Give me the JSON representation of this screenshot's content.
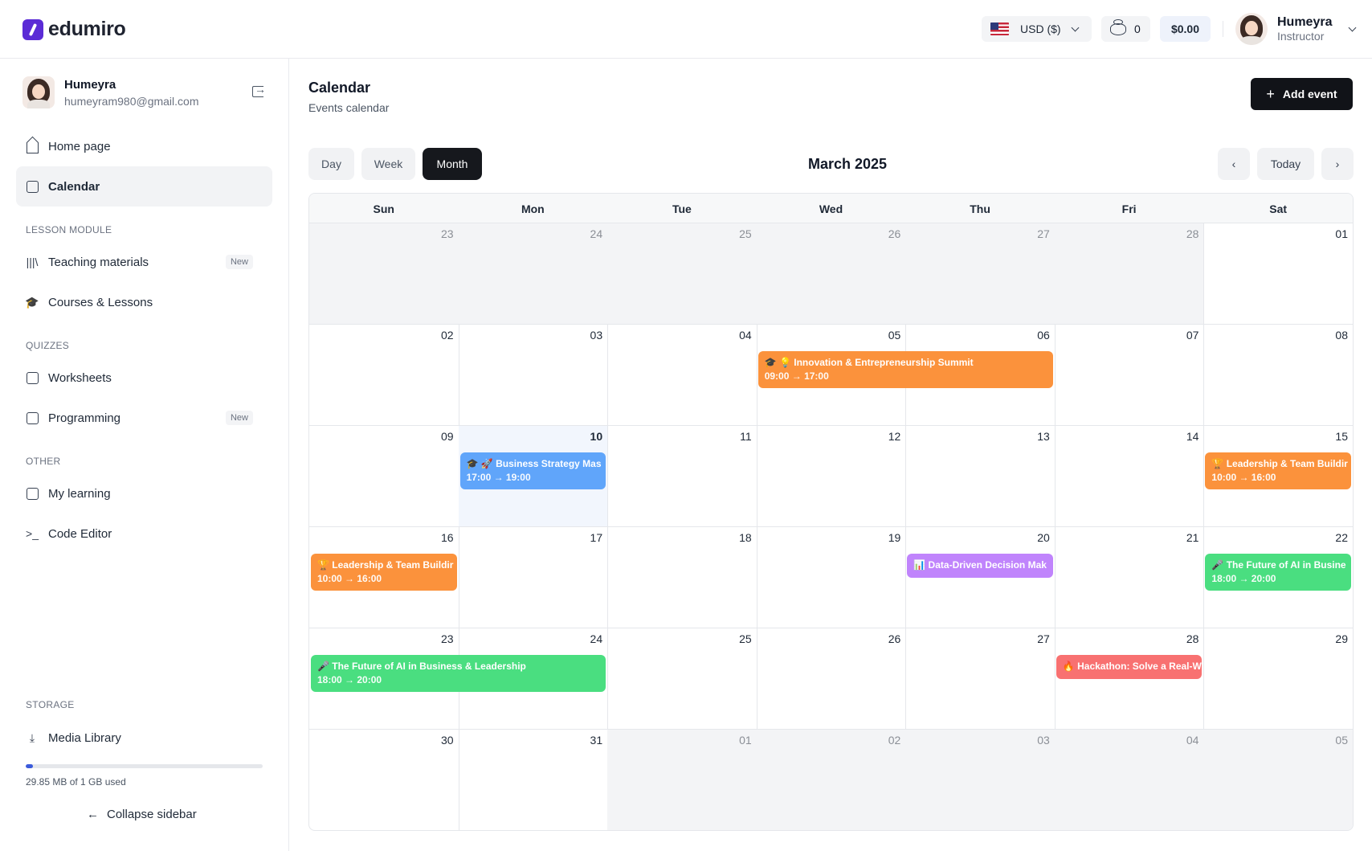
{
  "brand": {
    "name": "edumiro"
  },
  "topbar": {
    "currency_label": "USD ($)",
    "coins_count": "0",
    "balance": "$0.00",
    "user_name": "Humeyra",
    "user_role": "Instructor"
  },
  "sidebar": {
    "user_name": "Humeyra",
    "user_email": "humeyram980@gmail.com",
    "items": {
      "home": "Home page",
      "calendar": "Calendar",
      "teaching": "Teaching materials",
      "courses": "Courses & Lessons",
      "worksheets": "Worksheets",
      "programming": "Programming",
      "learning": "My learning",
      "code_editor": "Code Editor",
      "media": "Media Library"
    },
    "badge_new": "New",
    "sections": {
      "lesson_module": "LESSON MODULE",
      "quizzes": "QUIZZES",
      "other": "OTHER",
      "storage": "STORAGE"
    },
    "storage": {
      "text": "29.85 MB of 1 GB used",
      "used_fraction": 0.03
    },
    "collapse": "Collapse sidebar"
  },
  "main": {
    "title": "Calendar",
    "subtitle": "Events calendar",
    "add_event": "Add event",
    "views": {
      "day": "Day",
      "week": "Week",
      "month": "Month",
      "active": "Month"
    },
    "month_title": "March 2025",
    "today": "Today"
  },
  "calendar": {
    "weekdays": [
      "Sun",
      "Mon",
      "Tue",
      "Wed",
      "Thu",
      "Fri",
      "Sat"
    ],
    "weeks": [
      [
        {
          "d": "23",
          "out": true
        },
        {
          "d": "24",
          "out": true
        },
        {
          "d": "25",
          "out": true
        },
        {
          "d": "26",
          "out": true
        },
        {
          "d": "27",
          "out": true
        },
        {
          "d": "28",
          "out": true
        },
        {
          "d": "01"
        }
      ],
      [
        {
          "d": "02"
        },
        {
          "d": "03"
        },
        {
          "d": "04"
        },
        {
          "d": "05"
        },
        {
          "d": "06"
        },
        {
          "d": "07"
        },
        {
          "d": "08"
        }
      ],
      [
        {
          "d": "09"
        },
        {
          "d": "10",
          "today": true
        },
        {
          "d": "11"
        },
        {
          "d": "12"
        },
        {
          "d": "13"
        },
        {
          "d": "14"
        },
        {
          "d": "15"
        }
      ],
      [
        {
          "d": "16"
        },
        {
          "d": "17"
        },
        {
          "d": "18"
        },
        {
          "d": "19"
        },
        {
          "d": "20"
        },
        {
          "d": "21"
        },
        {
          "d": "22"
        }
      ],
      [
        {
          "d": "23"
        },
        {
          "d": "24"
        },
        {
          "d": "25"
        },
        {
          "d": "26"
        },
        {
          "d": "27"
        },
        {
          "d": "28"
        },
        {
          "d": "29"
        }
      ],
      [
        {
          "d": "30"
        },
        {
          "d": "31"
        },
        {
          "d": "01",
          "out": true
        },
        {
          "d": "02",
          "out": true
        },
        {
          "d": "03",
          "out": true
        },
        {
          "d": "04",
          "out": true
        },
        {
          "d": "05",
          "out": true
        }
      ]
    ],
    "events": [
      {
        "title": "🎓 💡 Innovation & Entrepreneurship Summit",
        "time": "09:00 → 17:00",
        "week": 1,
        "start": 3,
        "span": 2,
        "color": "orange"
      },
      {
        "title": "🎓 🚀 Business Strategy Mas",
        "time": "17:00 → 19:00",
        "week": 2,
        "start": 1,
        "span": 1,
        "color": "blue"
      },
      {
        "title": "🏆 Leadership & Team Buildir",
        "time": "10:00 → 16:00",
        "week": 2,
        "start": 6,
        "span": 1,
        "color": "orange"
      },
      {
        "title": "🏆 Leadership & Team Buildir",
        "time": "10:00 → 16:00",
        "week": 3,
        "start": 0,
        "span": 1,
        "color": "orange"
      },
      {
        "title": "📊 Data-Driven Decision Mak",
        "time": "",
        "week": 3,
        "start": 4,
        "span": 1,
        "color": "purple"
      },
      {
        "title": "🎤 The Future of AI in Busine",
        "time": "18:00 → 20:00",
        "week": 3,
        "start": 6,
        "span": 1,
        "color": "green"
      },
      {
        "title": "🎤 The Future of AI in Business & Leadership",
        "time": "18:00 → 20:00",
        "week": 4,
        "start": 0,
        "span": 2,
        "color": "green"
      },
      {
        "title": "🔥 Hackathon: Solve a Real-W",
        "time": "",
        "week": 4,
        "start": 5,
        "span": 1,
        "color": "red"
      }
    ]
  }
}
